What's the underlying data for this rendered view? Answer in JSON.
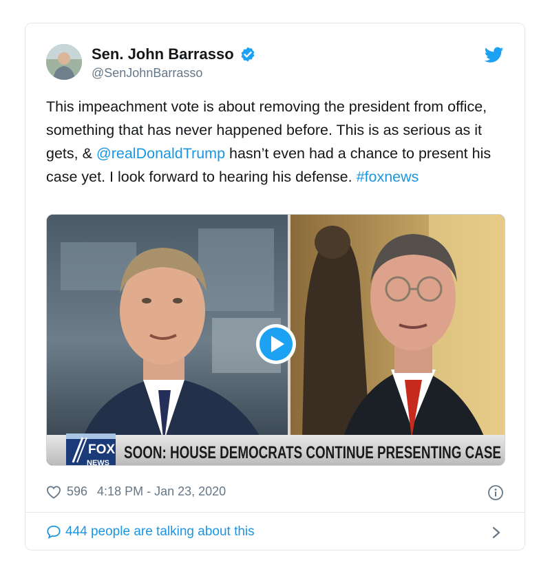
{
  "author": {
    "display_name": "Sen. John Barrasso",
    "handle": "@SenJohnBarrasso",
    "verified": true
  },
  "tweet": {
    "text_part1": "This impeachment vote is about removing the president from office, something that has never happened before. This is as serious as it gets, & ",
    "mention": "@realDonaldTrump",
    "text_part2": " hasn’t even had a chance to present his case yet. I look forward to hearing his defense. ",
    "hashtag": "#foxnews"
  },
  "media": {
    "type": "video",
    "network_logo_top": "FOX",
    "network_logo_bottom": "NEWS",
    "chyron": "SOON: HOUSE DEMOCRATS CONTINUE PRESENTING CASE",
    "play_icon": "play-icon"
  },
  "meta": {
    "like_count": "596",
    "timestamp": "4:18 PM - Jan 23, 2020"
  },
  "footer": {
    "talking_text": "444 people are talking about this"
  },
  "colors": {
    "link": "#1b95e0",
    "text": "#14171a",
    "muted": "#657786",
    "border": "#e1e8ed"
  }
}
